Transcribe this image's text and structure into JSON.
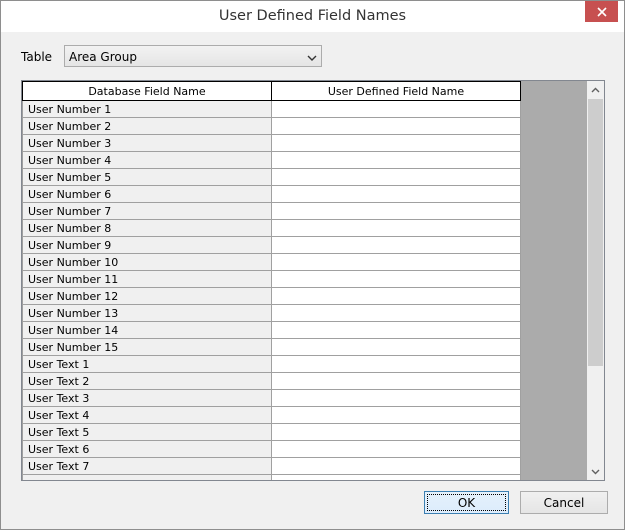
{
  "window": {
    "title": "User Defined Field Names"
  },
  "table_selector": {
    "label": "Table",
    "selected": "Area Group"
  },
  "grid": {
    "columns": [
      "Database Field Name",
      "User Defined Field Name"
    ],
    "rows": [
      {
        "db": "User Number 1",
        "user": ""
      },
      {
        "db": "User Number 2",
        "user": ""
      },
      {
        "db": "User Number 3",
        "user": ""
      },
      {
        "db": "User Number 4",
        "user": ""
      },
      {
        "db": "User Number 5",
        "user": ""
      },
      {
        "db": "User Number 6",
        "user": ""
      },
      {
        "db": "User Number 7",
        "user": ""
      },
      {
        "db": "User Number 8",
        "user": ""
      },
      {
        "db": "User Number 9",
        "user": ""
      },
      {
        "db": "User Number 10",
        "user": ""
      },
      {
        "db": "User Number 11",
        "user": ""
      },
      {
        "db": "User Number 12",
        "user": ""
      },
      {
        "db": "User Number 13",
        "user": ""
      },
      {
        "db": "User Number 14",
        "user": ""
      },
      {
        "db": "User Number 15",
        "user": ""
      },
      {
        "db": "User Text 1",
        "user": ""
      },
      {
        "db": "User Text 2",
        "user": ""
      },
      {
        "db": "User Text 3",
        "user": ""
      },
      {
        "db": "User Text 4",
        "user": ""
      },
      {
        "db": "User Text 5",
        "user": ""
      },
      {
        "db": "User Text 6",
        "user": ""
      },
      {
        "db": "User Text 7",
        "user": ""
      },
      {
        "db": "",
        "user": ""
      }
    ]
  },
  "buttons": {
    "ok": "OK",
    "cancel": "Cancel"
  },
  "colors": {
    "close_button": "#c75050",
    "grid_background": "#ababab",
    "readonly_cell": "#f0f0f0"
  },
  "icons": {
    "close": "close-icon",
    "dropdown": "chevron-down-icon",
    "scroll_up": "chevron-up-icon",
    "scroll_down": "chevron-down-icon"
  }
}
